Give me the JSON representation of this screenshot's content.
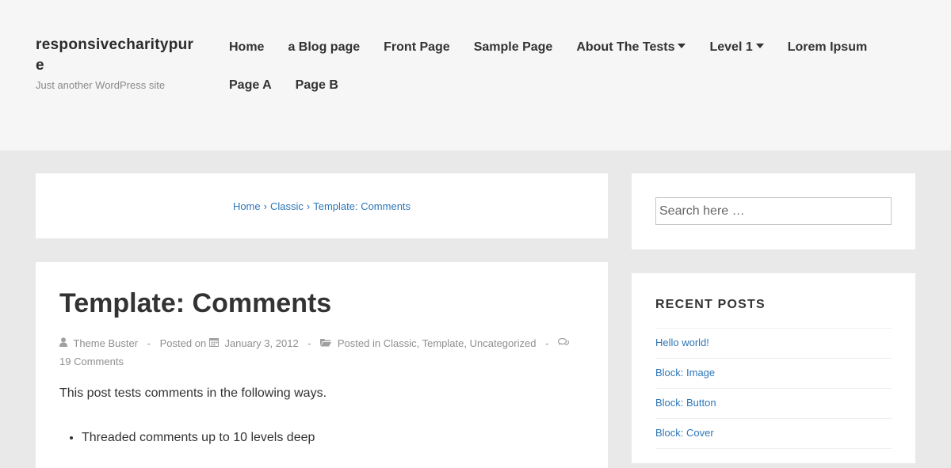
{
  "header": {
    "site_title": "responsivecharitypure",
    "tagline": "Just another WordPress site"
  },
  "nav": {
    "items": [
      {
        "label": "Home"
      },
      {
        "label": "a Blog page"
      },
      {
        "label": "Front Page"
      },
      {
        "label": "Sample Page"
      },
      {
        "label": "About The Tests"
      },
      {
        "label": "Level 1"
      },
      {
        "label": "Lorem Ipsum"
      },
      {
        "label": "Page A"
      },
      {
        "label": "Page B"
      }
    ]
  },
  "breadcrumb": {
    "home": "Home",
    "sep": "›",
    "category": "Classic",
    "current": "Template: Comments"
  },
  "post": {
    "title": "Template: Comments",
    "author": "Theme Buster",
    "posted_on_label": "Posted on",
    "date": "January 3, 2012",
    "posted_in_label": "Posted in",
    "categories": [
      "Classic",
      "Template",
      "Uncategorized"
    ],
    "comment_count": "19",
    "comments_label": "Comments",
    "dash": "-",
    "intro": "This post tests comments in the following ways.",
    "bullets": [
      "Threaded comments up to 10 levels deep"
    ]
  },
  "sidebar": {
    "search_placeholder": "Search here …",
    "recent_title": "RECENT POSTS",
    "recent_posts": [
      "Hello world!",
      "Block: Image",
      "Block: Button",
      "Block: Cover"
    ]
  },
  "colors": {
    "link": "#2e76b8",
    "header_bg": "#f6f6f6",
    "page_bg": "#e9e9e9"
  },
  "icons": {
    "author": "user-icon",
    "date": "calendar-icon",
    "categories": "folder-icon",
    "comments": "comments-icon",
    "dropdown": "caret-down-icon"
  }
}
